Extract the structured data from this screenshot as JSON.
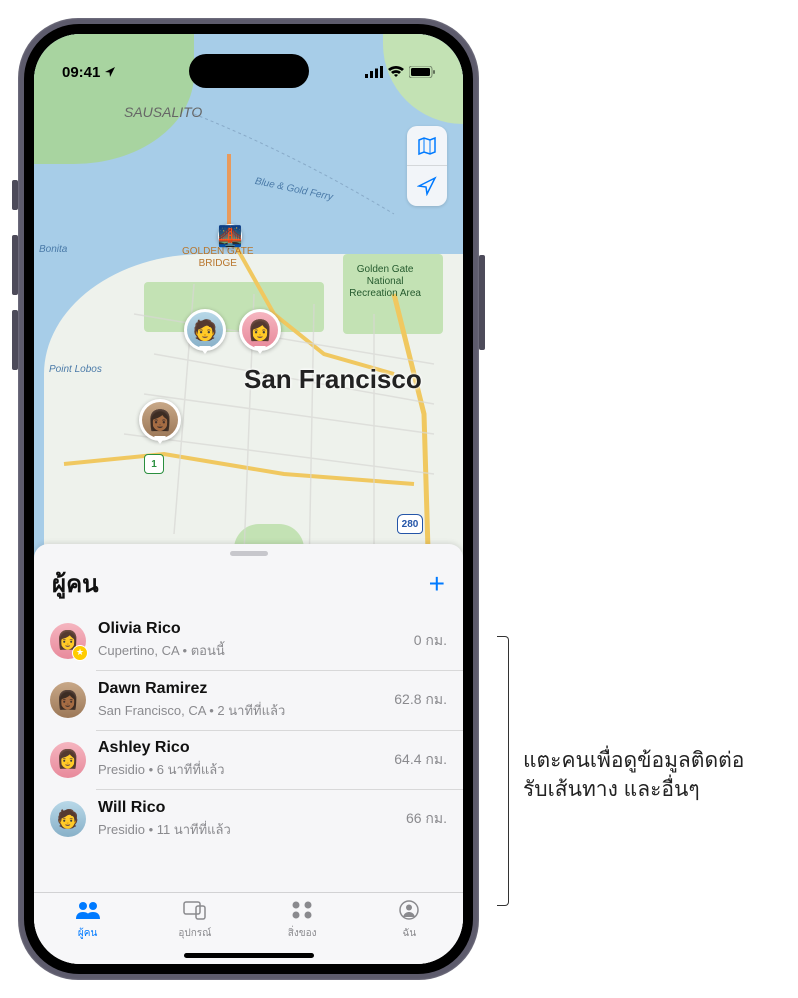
{
  "status": {
    "time": "09:41",
    "location_arrow": "▸"
  },
  "map": {
    "city_label": "San Francisco",
    "labels": {
      "sausalito": "SAUSALITO",
      "golden_gate_bridge": "GOLDEN GATE\nBRIDGE",
      "recreation_area": "Golden Gate\nNational\nRecreation Area",
      "blue_gold_ferry": "Blue & Gold Ferry",
      "point_bonita": "Bonita",
      "point_lobos": "Point Lobos"
    },
    "shields": {
      "ca1": "1",
      "i280": "280"
    },
    "controls": {
      "map_mode": "map-mode-icon",
      "locate": "locate-icon"
    },
    "pins": [
      {
        "id": "bridge",
        "class": "av-bridge",
        "emoji": "🌉"
      },
      {
        "id": "p1",
        "class": "av-4",
        "emoji": "🧑"
      },
      {
        "id": "p2",
        "class": "av-1",
        "emoji": "👩"
      },
      {
        "id": "p3",
        "class": "av-3",
        "emoji": "👩🏾"
      }
    ]
  },
  "sheet": {
    "title": "ผู้คน",
    "people": [
      {
        "name": "Olivia Rico",
        "location": "Cupertino, CA",
        "time": "ตอนนี้",
        "distance": "0 กม.",
        "avatar_class": "av-1",
        "emoji": "👩",
        "favorite": true
      },
      {
        "name": "Dawn Ramirez",
        "location": "San Francisco, CA",
        "time": "2 นาทีที่แล้ว",
        "distance": "62.8 กม.",
        "avatar_class": "av-3",
        "emoji": "👩🏾",
        "favorite": false
      },
      {
        "name": "Ashley Rico",
        "location": "Presidio",
        "time": "6 นาทีที่แล้ว",
        "distance": "64.4 กม.",
        "avatar_class": "av-1",
        "emoji": "👩",
        "favorite": false
      },
      {
        "name": "Will Rico",
        "location": "Presidio",
        "time": "11 นาทีที่แล้ว",
        "distance": "66 กม.",
        "avatar_class": "av-4",
        "emoji": "🧑",
        "favorite": false
      }
    ]
  },
  "tabs": [
    {
      "label": "ผู้คน",
      "icon": "people",
      "active": true
    },
    {
      "label": "อุปกรณ์",
      "icon": "devices",
      "active": false
    },
    {
      "label": "สิ่งของ",
      "icon": "items",
      "active": false
    },
    {
      "label": "ฉัน",
      "icon": "me",
      "active": false
    }
  ],
  "annotation": {
    "line1": "แตะคนเพื่อดูข้อมูลติดต่อ",
    "line2": "รับเส้นทาง และอื่นๆ"
  }
}
